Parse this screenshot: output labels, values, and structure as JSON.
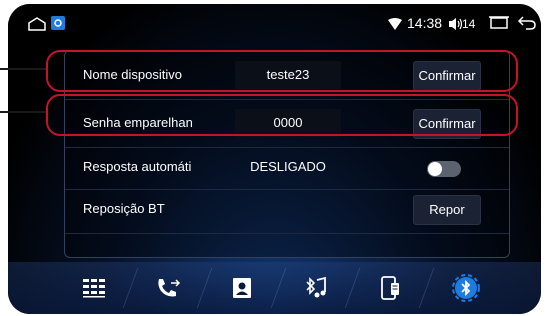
{
  "status_bar": {
    "time": "14:38",
    "volume_level": "14",
    "icons": [
      "home-icon",
      "app-notification-icon",
      "wifi-icon",
      "volume-icon",
      "recent-apps-icon",
      "back-icon"
    ]
  },
  "settings": {
    "rows": [
      {
        "label": "Nome dispositivo",
        "value": "teste23",
        "action": "Confirmar"
      },
      {
        "label": "Senha emparelhan",
        "value": "0000",
        "action": "Confirmar"
      },
      {
        "label": "Resposta automáti",
        "value": "DESLIGADO",
        "toggle_on": false
      },
      {
        "label": "Reposição BT",
        "action": "Repor"
      }
    ]
  },
  "dock": {
    "items": [
      "dialpad-icon",
      "call-log-icon",
      "contacts-icon",
      "bluetooth-music-icon",
      "phone-transfer-icon",
      "bluetooth-settings-icon"
    ],
    "active_index": 5
  },
  "colors": {
    "highlight": "#c8122a",
    "accent": "#1e7be0",
    "background": "#000000"
  }
}
